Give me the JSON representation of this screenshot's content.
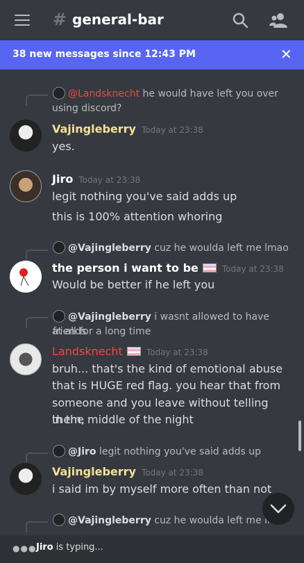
{
  "header": {
    "hash_icon": "hash-icon",
    "title": "general-bar",
    "search_icon": "search-icon",
    "members_icon": "members-icon",
    "menu_icon": "hamburger-icon"
  },
  "banner": {
    "text": "38 new messages since 12:43 PM",
    "close": "✕"
  },
  "messages": [
    {
      "reply": {
        "name": "@Landsknecht",
        "text": " he would have left you over",
        "text2": "using discord?"
      },
      "author": "Vajingleberry",
      "time": "Today at 23:38",
      "lines": [
        "yes."
      ]
    },
    {
      "author": "Jiro",
      "time": "Today at 23:38",
      "lines": [
        "legit nothing you've said adds up",
        "this is 100% attention whoring"
      ]
    },
    {
      "reply": {
        "name": "@Vajingleberry",
        "text": " cuz he woulda left me lmao"
      },
      "author": "the person i want to be",
      "time": "Today at 23:38",
      "lines": [
        "Would be better if he left you"
      ]
    },
    {
      "reply": {
        "name": "@Vajingleberry",
        "text": " i wasnt allowed to have friends",
        "text2": "at all for a long time"
      },
      "author": "Landsknecht",
      "time": "Today at 23:38",
      "lines": [
        "bruh... that's the kind of emotional abuse",
        "that is HUGE red flag. you hear that from",
        "someone and you leave without telling them,",
        "in the middle of the night"
      ]
    },
    {
      "reply": {
        "name": "@Jiro",
        "text": " legit nothing you've said adds up"
      },
      "author": "Vajingleberry",
      "time": "Today at 23:38",
      "lines": [
        "i said im by myself more often than not"
      ]
    },
    {
      "reply": {
        "name": "@Vajingleberry",
        "text": " cuz he woulda left me lma"
      }
    }
  ],
  "typing": {
    "name": "Jiro",
    "suffix": " is typing..."
  },
  "colors": {
    "background": "#36393f",
    "banner": "#5865f2",
    "name_yellow": "#f3e196",
    "name_red": "#f04747"
  }
}
